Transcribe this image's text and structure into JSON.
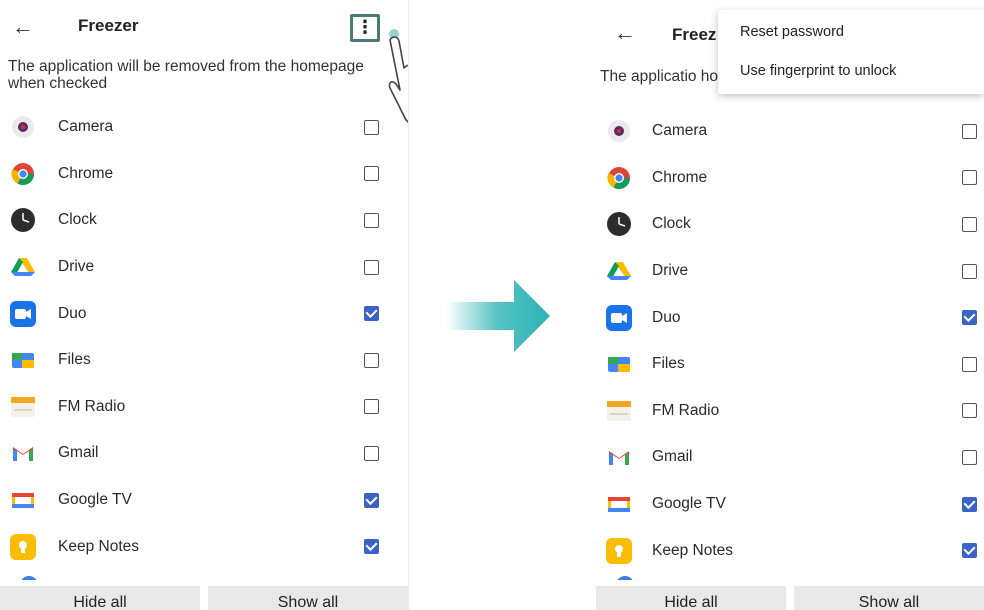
{
  "left": {
    "title": "Freezer",
    "back_icon": "arrow-left-icon",
    "menu_icon": "more-vertical-icon",
    "description": "The application will be removed from the homepage when checked",
    "apps": [
      {
        "label": "Camera",
        "checked": false
      },
      {
        "label": "Chrome",
        "checked": false
      },
      {
        "label": "Clock",
        "checked": false
      },
      {
        "label": "Drive",
        "checked": false
      },
      {
        "label": "Duo",
        "checked": true
      },
      {
        "label": "Files",
        "checked": false
      },
      {
        "label": "FM Radio",
        "checked": false
      },
      {
        "label": "Gmail",
        "checked": false
      },
      {
        "label": "Google TV",
        "checked": true
      },
      {
        "label": "Keep Notes",
        "checked": true
      }
    ],
    "hide_all": "Hide all",
    "show_all": "Show all"
  },
  "right": {
    "title": "Freez",
    "description": "The applicatio homepage when checked",
    "menu": {
      "reset_password": "Reset password",
      "use_fingerprint": "Use fingerprint to unlock",
      "fingerprint_checked": false
    },
    "apps": [
      {
        "label": "Camera",
        "checked": false
      },
      {
        "label": "Chrome",
        "checked": false
      },
      {
        "label": "Clock",
        "checked": false
      },
      {
        "label": "Drive",
        "checked": false
      },
      {
        "label": "Duo",
        "checked": true
      },
      {
        "label": "Files",
        "checked": false
      },
      {
        "label": "FM Radio",
        "checked": false
      },
      {
        "label": "Gmail",
        "checked": false
      },
      {
        "label": "Google TV",
        "checked": true
      },
      {
        "label": "Keep Notes",
        "checked": true
      }
    ],
    "hide_all": "Hide all",
    "show_all": "Show all"
  },
  "colors": {
    "accent": "#3b63c4",
    "arrow": "#2bb3b3",
    "highlight_border": "#4b7b78"
  }
}
